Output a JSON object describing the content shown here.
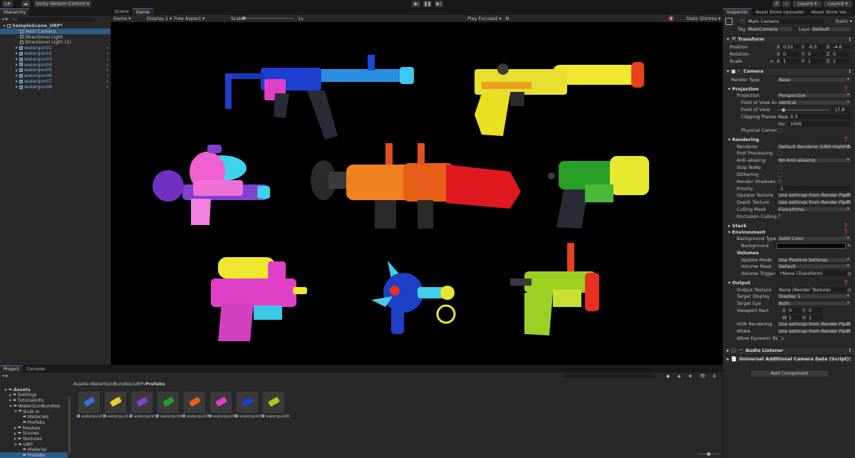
{
  "toolbar": {
    "account": "L",
    "version_control": "Unity Version Control",
    "layers": "Layers",
    "layout": "Layout"
  },
  "hierarchy": {
    "tab": "Hierarchy",
    "search_placeholder": "All",
    "scene": "SampleScene_URP*",
    "items": [
      {
        "label": "Main Camera",
        "type": "go",
        "selected": true
      },
      {
        "label": "Directional Light",
        "type": "go"
      },
      {
        "label": "Directional Light (1)",
        "type": "go"
      },
      {
        "label": "watergun01",
        "type": "prefab"
      },
      {
        "label": "watergun02",
        "type": "prefab"
      },
      {
        "label": "watergun03",
        "type": "prefab"
      },
      {
        "label": "watergun04",
        "type": "prefab"
      },
      {
        "label": "watergun05",
        "type": "prefab"
      },
      {
        "label": "watergun06",
        "type": "prefab"
      },
      {
        "label": "watergun07",
        "type": "prefab"
      },
      {
        "label": "watergun08",
        "type": "prefab"
      }
    ]
  },
  "view_tabs": {
    "scene": "Scene",
    "game": "Game"
  },
  "gamebar": {
    "mode": "Game",
    "display": "Display 1",
    "aspect": "Free Aspect",
    "scale_label": "Scale",
    "scale_value": "1x",
    "play_focused": "Play Focused",
    "stats": "Stats",
    "gizmos": "Gizmos"
  },
  "inspector": {
    "tabs": [
      "Inspector",
      "Asset Store Uploader",
      "Asset Store Val..."
    ],
    "object_name": "Main Camera",
    "static": "Static",
    "tag_label": "Tag",
    "tag": "MainCamera",
    "layer_label": "Layer",
    "layer": "Default",
    "transform": {
      "title": "Transform",
      "position": {
        "label": "Position",
        "x": "0.51",
        "y": "-0.5",
        "z": "-4.6"
      },
      "rotation": {
        "label": "Rotation",
        "x": "0",
        "y": "0",
        "z": "0"
      },
      "scale": {
        "label": "Scale",
        "x": "1",
        "y": "1",
        "z": "1"
      }
    },
    "camera": {
      "title": "Camera",
      "render_type_label": "Render Type",
      "render_type": "Base",
      "projection_section": "Projection",
      "projection_label": "Projection",
      "projection": "Perspective",
      "fov_axis_label": "Field of View Axis",
      "fov_axis": "Vertical",
      "fov_label": "Field of View",
      "fov": "17.8",
      "fov_fraction": 0.1,
      "clipping_label": "Clipping Planes",
      "near_label": "Near",
      "near": "0.3",
      "far_label": "Far",
      "far": "1000",
      "physical_label": "Physical Camera",
      "rendering_section": "Rendering",
      "renderer_label": "Renderer",
      "renderer": "Default Renderer (URP-HighFidelity",
      "post_label": "Post Processing",
      "aa_label": "Anti-aliasing",
      "aa": "No Anti-aliasing",
      "stopnans_label": "Stop NaNs",
      "dither_label": "Dithering",
      "shadows_label": "Render Shadows",
      "priority_label": "Priority",
      "priority": "-1",
      "opaque_label": "Opaque Texture",
      "opaque": "Use settings from Render Pipeline A",
      "depth_label": "Depth Texture",
      "depth": "Use settings from Render Pipeline A",
      "culling_label": "Culling Mask",
      "culling": "Everything",
      "occlusion_label": "Occlusion Culling",
      "stack_section": "Stack",
      "environment_section": "Environment",
      "bgtype_label": "Background Type",
      "bgtype": "Solid Color",
      "background_label": "Background",
      "volumes_section": "Volumes",
      "update_label": "Update Mode",
      "update": "Use Pipeline Settings",
      "vmask_label": "Volume Mask",
      "vmask": "Default",
      "vtrigger_label": "Volume Trigger",
      "vtrigger": "↗None (Transform)",
      "output_section": "Output",
      "outtex_label": "Output Texture",
      "outtex": "None (Render Texture)",
      "targetdisp_label": "Target Display",
      "targetdisp": "Display 1",
      "targeteye_label": "Target Eye",
      "targeteye": "Both",
      "viewport_label": "Viewport Rect",
      "vx_label": "X",
      "vx": "0",
      "vy_label": "Y",
      "vy": "0",
      "vw_label": "W",
      "vw": "1",
      "vh_label": "H",
      "vh": "1",
      "hdr_label": "HDR Rendering",
      "hdr": "Use settings from Render Pipeline A",
      "msaa_label": "MSAA",
      "msaa": "Use settings from Render Pipeline A",
      "dynres_label": "Allow Dynamic Reso"
    },
    "audio_listener": "Audio Listener",
    "urp_data": "Universal Additional Camera Data (Script)",
    "add_component": "Add Component"
  },
  "project": {
    "tabs": [
      "Project",
      "Console"
    ],
    "tree": [
      {
        "label": "Assets",
        "depth": 0,
        "bold": true
      },
      {
        "label": "Settings",
        "depth": 1
      },
      {
        "label": "TutorialInfo",
        "depth": 1
      },
      {
        "label": "WaterGunBundles",
        "depth": 1
      },
      {
        "label": "Built-in",
        "depth": 2
      },
      {
        "label": "Materials",
        "depth": 3
      },
      {
        "label": "Prefabs",
        "depth": 3
      },
      {
        "label": "Meshes",
        "depth": 2
      },
      {
        "label": "Scenes",
        "depth": 2
      },
      {
        "label": "Textures",
        "depth": 2
      },
      {
        "label": "URP",
        "depth": 2
      },
      {
        "label": "Material",
        "depth": 3
      },
      {
        "label": "Prefabs",
        "depth": 3,
        "selected": true
      }
    ],
    "breadcrumb": [
      "Assets",
      "WaterGunBundles",
      "URP",
      "Prefabs"
    ],
    "assets": [
      "watergun01",
      "watergun02",
      "watergun03",
      "watergun04",
      "watergun05",
      "watergun06",
      "watergun07",
      "watergun08"
    ],
    "hidden_count": "8"
  }
}
